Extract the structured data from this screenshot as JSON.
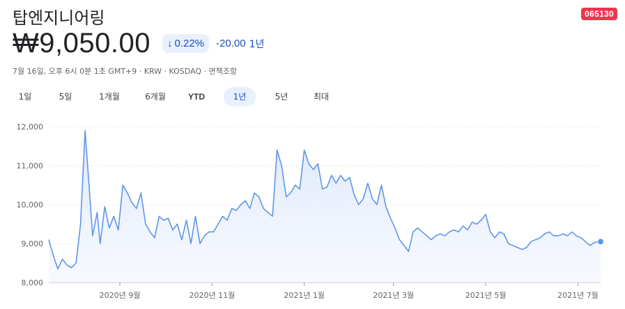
{
  "stock": {
    "name": "탑엔지니어링",
    "ticker": "065130",
    "price": "₩9,050.00",
    "change_pct": "0.22%",
    "change_abs": "-20.00",
    "change_period": "1년",
    "meta": "7월 16일, 오후 6시 0분 1초 GMT+9 · KRW · KOSDAQ · 면책조항"
  },
  "icons": {
    "change_arrow": "arrow-down-icon"
  },
  "colors": {
    "line": "#5f96e8",
    "ticker_bg": "#e8384f",
    "change": "#1a4fb6"
  },
  "tabs": [
    {
      "label": "1일",
      "active": false
    },
    {
      "label": "5일",
      "active": false
    },
    {
      "label": "1개월",
      "active": false
    },
    {
      "label": "6개월",
      "active": false
    },
    {
      "label": "YTD",
      "active": false
    },
    {
      "label": "1년",
      "active": true
    },
    {
      "label": "5년",
      "active": false
    },
    {
      "label": "최대",
      "active": false
    }
  ],
  "chart_data": {
    "type": "area",
    "ylim": [
      8000,
      12000
    ],
    "yticks": [
      8000,
      9000,
      10000,
      11000,
      12000
    ],
    "ytick_labels": [
      "8,000",
      "9,000",
      "10,000",
      "11,000",
      "12,000"
    ],
    "xtick_labels": [
      "2020년 9월",
      "2020년 11월",
      "2021년 1월",
      "2021년 3월",
      "2021년 5월",
      "2021년 7월"
    ],
    "x_range": [
      "2020-07-16",
      "2021-07-16"
    ],
    "xtick_dates": [
      "2020-09-01",
      "2020-11-01",
      "2021-01-01",
      "2021-03-01",
      "2021-05-01",
      "2021-07-01"
    ],
    "grid": true,
    "x": [
      "2020-07-16",
      "2020-07-19",
      "2020-07-22",
      "2020-07-25",
      "2020-07-28",
      "2020-07-31",
      "2020-08-03",
      "2020-08-06",
      "2020-08-09",
      "2020-08-12",
      "2020-08-14",
      "2020-08-17",
      "2020-08-19",
      "2020-08-22",
      "2020-08-25",
      "2020-08-28",
      "2020-08-31",
      "2020-09-03",
      "2020-09-06",
      "2020-09-09",
      "2020-09-12",
      "2020-09-15",
      "2020-09-18",
      "2020-09-21",
      "2020-09-24",
      "2020-09-27",
      "2020-09-30",
      "2020-10-03",
      "2020-10-06",
      "2020-10-09",
      "2020-10-12",
      "2020-10-15",
      "2020-10-18",
      "2020-10-21",
      "2020-10-24",
      "2020-10-27",
      "2020-10-30",
      "2020-11-02",
      "2020-11-05",
      "2020-11-08",
      "2020-11-11",
      "2020-11-14",
      "2020-11-17",
      "2020-11-20",
      "2020-11-23",
      "2020-11-26",
      "2020-11-29",
      "2020-12-02",
      "2020-12-05",
      "2020-12-08",
      "2020-12-11",
      "2020-12-14",
      "2020-12-17",
      "2020-12-20",
      "2020-12-23",
      "2020-12-26",
      "2020-12-29",
      "2021-01-01",
      "2021-01-04",
      "2021-01-07",
      "2021-01-10",
      "2021-01-13",
      "2021-01-16",
      "2021-01-19",
      "2021-01-22",
      "2021-01-25",
      "2021-01-28",
      "2021-01-31",
      "2021-02-03",
      "2021-02-06",
      "2021-02-09",
      "2021-02-12",
      "2021-02-15",
      "2021-02-18",
      "2021-02-21",
      "2021-02-24",
      "2021-02-27",
      "2021-03-02",
      "2021-03-05",
      "2021-03-08",
      "2021-03-11",
      "2021-03-14",
      "2021-03-17",
      "2021-03-20",
      "2021-03-23",
      "2021-03-26",
      "2021-03-29",
      "2021-04-01",
      "2021-04-04",
      "2021-04-07",
      "2021-04-10",
      "2021-04-13",
      "2021-04-16",
      "2021-04-19",
      "2021-04-22",
      "2021-04-25",
      "2021-04-28",
      "2021-05-01",
      "2021-05-04",
      "2021-05-07",
      "2021-05-10",
      "2021-05-13",
      "2021-05-16",
      "2021-05-19",
      "2021-05-22",
      "2021-05-25",
      "2021-05-28",
      "2021-05-31",
      "2021-06-03",
      "2021-06-06",
      "2021-06-09",
      "2021-06-12",
      "2021-06-15",
      "2021-06-18",
      "2021-06-21",
      "2021-06-24",
      "2021-06-27",
      "2021-06-30",
      "2021-07-03",
      "2021-07-06",
      "2021-07-09",
      "2021-07-12",
      "2021-07-16"
    ],
    "series": [
      {
        "values": [
          9100,
          8700,
          8350,
          8600,
          8450,
          8380,
          8500,
          9500,
          11900,
          10300,
          9200,
          9800,
          9000,
          9950,
          9400,
          9700,
          9350,
          10500,
          10300,
          10050,
          9900,
          10300,
          9500,
          9300,
          9150,
          9700,
          9600,
          9650,
          9350,
          9500,
          9100,
          9600,
          9000,
          9700,
          9000,
          9200,
          9300,
          9300,
          9500,
          9700,
          9600,
          9900,
          9850,
          10000,
          10100,
          9900,
          10300,
          10200,
          9900,
          9800,
          9700,
          11400,
          11000,
          10200,
          10300,
          10500,
          10400,
          11400,
          11050,
          10900,
          11050,
          10400,
          10450,
          10750,
          10550,
          10750,
          10600,
          10700,
          10250,
          10000,
          10150,
          10550,
          10150,
          10000,
          10500,
          9950,
          9650,
          9400,
          9100,
          8950,
          8800,
          9300,
          9400,
          9300,
          9200,
          9100,
          9200,
          9250,
          9200,
          9300,
          9350,
          9300,
          9450,
          9350,
          9550,
          9500,
          9600,
          9750,
          9300,
          9150,
          9300,
          9250,
          9000,
          8950,
          8900,
          8850,
          8900,
          9050,
          9100,
          9150,
          9250,
          9300,
          9200,
          9200,
          9250,
          9200,
          9300,
          9200,
          9150,
          9050,
          8950,
          9030,
          9050
        ]
      }
    ]
  }
}
